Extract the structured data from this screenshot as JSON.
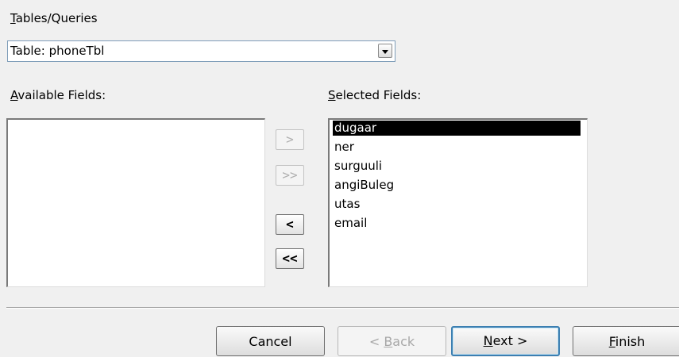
{
  "tables_queries": {
    "label": "Tables/Queries",
    "hotkey": "T",
    "selected_value": "Table: phoneTbl"
  },
  "available_fields": {
    "label": "Available Fields:",
    "hotkey": "A",
    "items": []
  },
  "selected_fields": {
    "label": "Selected Fields:",
    "hotkey": "S",
    "items": [
      "dugaar",
      "ner",
      "surguuli",
      "angiBuleg",
      "utas",
      "email"
    ],
    "selected_index": 0
  },
  "move_buttons": {
    "add_one": ">",
    "add_all": ">>",
    "remove_one": "<",
    "remove_all": "<<"
  },
  "footer": {
    "cancel": "Cancel",
    "back": "< Back",
    "next": "Next >",
    "finish": "Finish"
  }
}
